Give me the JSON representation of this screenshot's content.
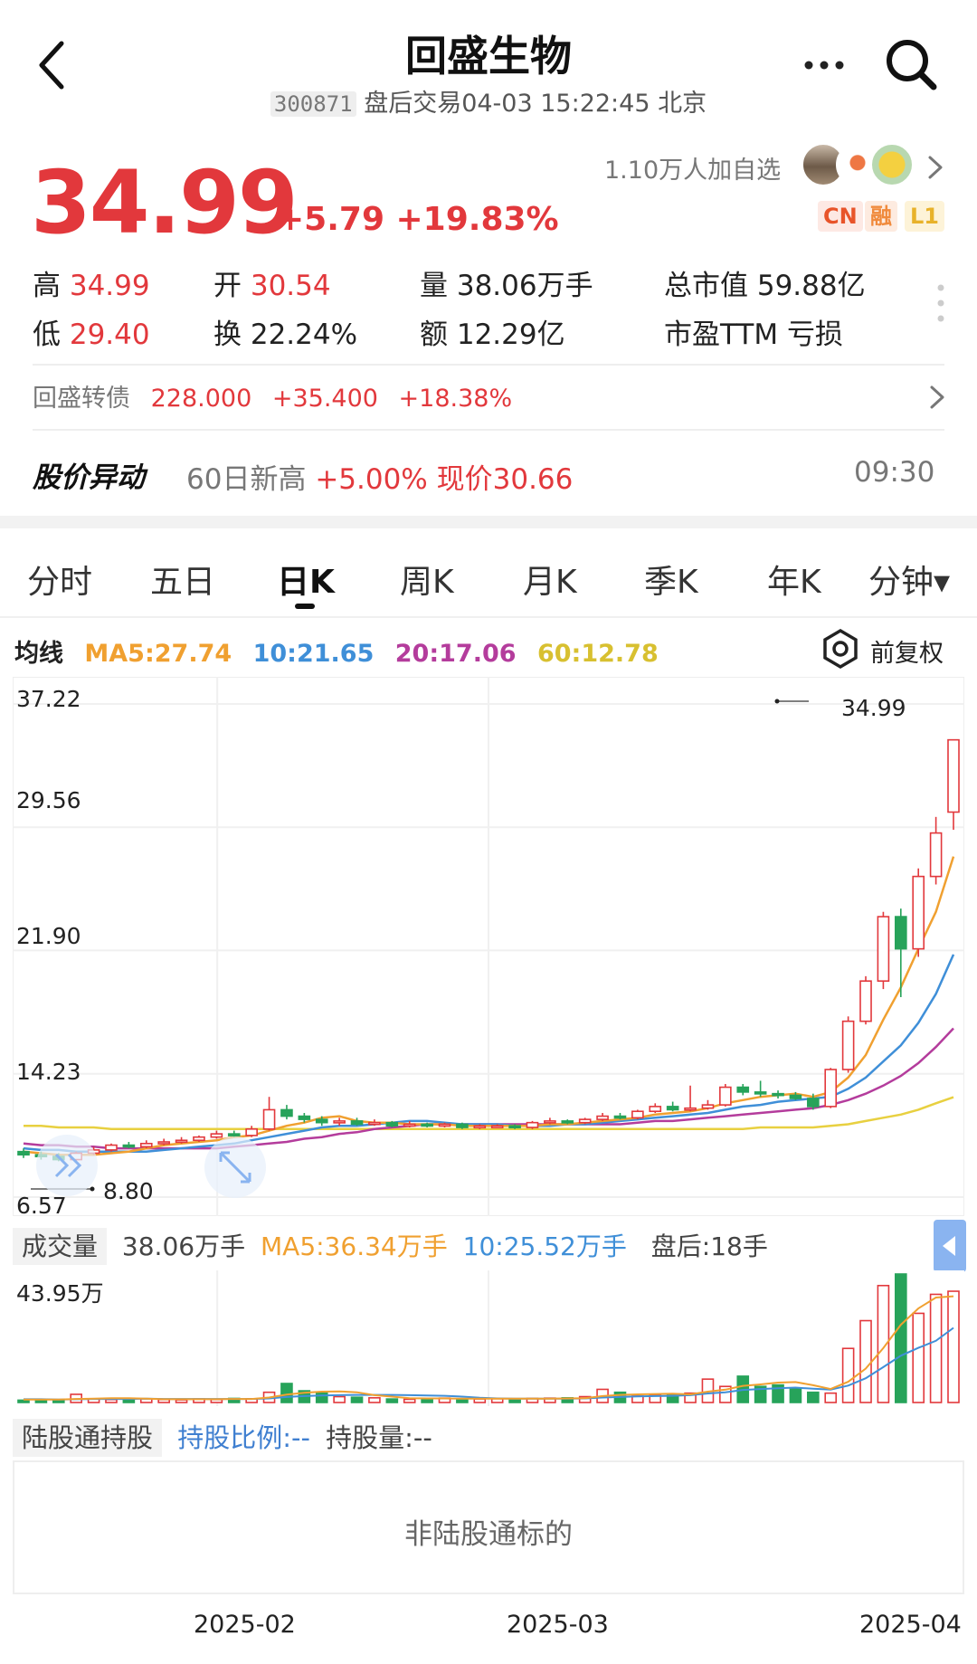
{
  "header": {
    "title": "回盛生物",
    "code": "300871",
    "status": "盘后交易04-03 15:22:45 北京"
  },
  "quote": {
    "price": "34.99",
    "change": "+5.79 +19.83%",
    "followers": "1.10万人加自选",
    "tags": [
      "CN",
      "融",
      "L1"
    ],
    "high_label": "高",
    "high": "34.99",
    "low_label": "低",
    "low": "29.40",
    "open_label": "开",
    "open": "30.54",
    "turnover_label": "换",
    "turnover": "22.24%",
    "volume_label": "量",
    "volume": "38.06万手",
    "amount_label": "额",
    "amount": "12.29亿",
    "mcap_label": "总市值",
    "mcap": "59.88亿",
    "pe_label": "市盈TTM",
    "pe": "亏损"
  },
  "bond": {
    "label": "回盛转债",
    "price": "228.000",
    "change": "+35.400",
    "pct": "+18.38%"
  },
  "alert": {
    "title": "股价异动",
    "text": "60日新高",
    "detail": "+5.00% 现价30.66",
    "time": "09:30"
  },
  "tabs": [
    "分时",
    "五日",
    "日K",
    "周K",
    "月K",
    "季K",
    "年K",
    "分钟▾"
  ],
  "ma": {
    "label": "均线",
    "ma5": "MA5:27.74",
    "ma10": "10:21.65",
    "ma20": "20:17.06",
    "ma60": "60:12.78",
    "adjust_label": "前复权"
  },
  "colors": {
    "up": "#e2383c",
    "down": "#27a35a",
    "ma5": "#f0a030",
    "ma10": "#3f8fd8",
    "ma20": "#b43c9c",
    "ma60": "#e8d040"
  },
  "kline": {
    "y_ticks": [
      "37.22",
      "29.56",
      "21.90",
      "14.23",
      "6.57"
    ],
    "high_mark": "34.99",
    "low_mark": "8.80"
  },
  "volume": {
    "label": "成交量",
    "value": "38.06万手",
    "ma5": "MA5:36.34万手",
    "ma10": "10:25.52万手",
    "after_hours": "盘后:18手",
    "max_label": "43.95万"
  },
  "hk_connect": {
    "label": "陆股通持股",
    "ratio": "持股比例:--",
    "amount": "持股量:--",
    "message": "非陆股通标的"
  },
  "dates": [
    "2025-02",
    "2025-03",
    "2025-04"
  ],
  "chart_data": {
    "type": "candlestick",
    "ylim": [
      6.57,
      37.22
    ],
    "y_ticks": [
      37.22,
      29.56,
      21.9,
      14.23,
      6.57
    ],
    "x_labels": [
      "2025-02",
      "2025-03",
      "2025-04"
    ],
    "candles": [
      [
        9.4,
        9.2,
        9.6,
        9.0
      ],
      [
        9.2,
        9.1,
        9.4,
        8.9
      ],
      [
        9.1,
        8.9,
        9.3,
        8.8
      ],
      [
        8.9,
        9.3,
        9.4,
        8.8
      ],
      [
        9.3,
        9.5,
        9.7,
        9.2
      ],
      [
        9.5,
        9.8,
        9.9,
        9.4
      ],
      [
        9.8,
        9.7,
        10.0,
        9.6
      ],
      [
        9.7,
        9.9,
        10.1,
        9.6
      ],
      [
        9.9,
        10.0,
        10.2,
        9.8
      ],
      [
        10.0,
        10.1,
        10.3,
        9.9
      ],
      [
        10.1,
        10.3,
        10.4,
        10.0
      ],
      [
        10.3,
        10.5,
        10.7,
        10.2
      ],
      [
        10.5,
        10.4,
        10.7,
        10.3
      ],
      [
        10.4,
        10.8,
        11.0,
        10.3
      ],
      [
        10.8,
        12.0,
        12.8,
        10.7
      ],
      [
        12.0,
        11.6,
        12.3,
        11.4
      ],
      [
        11.6,
        11.4,
        11.8,
        11.2
      ],
      [
        11.4,
        11.2,
        11.6,
        11.0
      ],
      [
        11.2,
        11.3,
        11.5,
        11.0
      ],
      [
        11.3,
        11.1,
        11.5,
        11.0
      ],
      [
        11.1,
        11.2,
        11.4,
        11.0
      ],
      [
        11.2,
        11.0,
        11.3,
        10.9
      ],
      [
        11.0,
        11.1,
        11.3,
        10.9
      ],
      [
        11.1,
        11.0,
        11.2,
        10.9
      ],
      [
        11.0,
        11.1,
        11.2,
        10.9
      ],
      [
        11.1,
        10.9,
        11.2,
        10.8
      ],
      [
        10.9,
        11.0,
        11.1,
        10.8
      ],
      [
        11.0,
        11.0,
        11.1,
        10.9
      ],
      [
        11.0,
        10.9,
        11.1,
        10.8
      ],
      [
        10.9,
        11.2,
        11.3,
        10.8
      ],
      [
        11.2,
        11.3,
        11.5,
        11.1
      ],
      [
        11.3,
        11.2,
        11.4,
        11.1
      ],
      [
        11.2,
        11.4,
        11.5,
        11.1
      ],
      [
        11.4,
        11.6,
        11.8,
        11.3
      ],
      [
        11.6,
        11.5,
        11.8,
        11.4
      ],
      [
        11.5,
        11.9,
        12.0,
        11.4
      ],
      [
        11.9,
        12.2,
        12.4,
        11.8
      ],
      [
        12.2,
        12.0,
        12.5,
        11.9
      ],
      [
        12.0,
        12.1,
        13.5,
        11.9
      ],
      [
        12.1,
        12.3,
        12.6,
        12.0
      ],
      [
        12.3,
        13.4,
        13.6,
        12.2
      ],
      [
        13.4,
        13.1,
        13.6,
        12.9
      ],
      [
        13.1,
        13.0,
        13.8,
        12.8
      ],
      [
        13.0,
        12.9,
        13.2,
        12.7
      ],
      [
        12.9,
        12.7,
        13.1,
        12.6
      ],
      [
        12.7,
        12.2,
        13.0,
        12.0
      ],
      [
        12.2,
        14.5,
        14.6,
        12.1
      ],
      [
        14.5,
        17.5,
        17.8,
        14.3
      ],
      [
        17.5,
        20.0,
        20.3,
        17.3
      ],
      [
        20.0,
        24.0,
        24.3,
        19.5
      ],
      [
        24.0,
        22.0,
        24.5,
        19.0
      ],
      [
        22.0,
        26.5,
        27.0,
        21.5
      ],
      [
        26.5,
        29.2,
        30.2,
        26.0
      ],
      [
        30.5,
        34.99,
        34.99,
        29.4
      ]
    ],
    "candle_fields": [
      "open",
      "close",
      "high",
      "low"
    ],
    "ma": {
      "MA5": [
        9.4,
        9.3,
        9.2,
        9.2,
        9.2,
        9.3,
        9.4,
        9.6,
        9.8,
        9.9,
        10.0,
        10.1,
        10.3,
        10.4,
        10.7,
        11.0,
        11.2,
        11.5,
        11.6,
        11.3,
        11.2,
        11.2,
        11.1,
        11.1,
        11.1,
        11.0,
        11.0,
        11.0,
        11.0,
        11.0,
        11.1,
        11.1,
        11.2,
        11.3,
        11.4,
        11.5,
        11.7,
        11.8,
        11.9,
        12.1,
        12.4,
        12.6,
        12.8,
        12.9,
        13.0,
        12.8,
        13.1,
        14.0,
        15.4,
        17.6,
        19.6,
        22.0,
        24.3,
        27.74
      ],
      "MA10": [
        9.6,
        9.5,
        9.5,
        9.4,
        9.4,
        9.4,
        9.4,
        9.4,
        9.5,
        9.6,
        9.7,
        9.8,
        9.9,
        10.1,
        10.3,
        10.5,
        10.7,
        10.9,
        11.0,
        11.0,
        11.1,
        11.2,
        11.3,
        11.3,
        11.2,
        11.1,
        11.1,
        11.1,
        11.0,
        11.0,
        11.0,
        11.1,
        11.1,
        11.2,
        11.3,
        11.4,
        11.5,
        11.6,
        11.7,
        11.8,
        12.0,
        12.2,
        12.3,
        12.5,
        12.6,
        12.7,
        12.8,
        13.3,
        14.0,
        15.0,
        16.0,
        17.4,
        19.2,
        21.65
      ],
      "MA20": [
        9.9,
        9.8,
        9.8,
        9.7,
        9.7,
        9.6,
        9.6,
        9.6,
        9.6,
        9.6,
        9.6,
        9.6,
        9.7,
        9.8,
        9.9,
        10.0,
        10.2,
        10.3,
        10.5,
        10.6,
        10.8,
        10.9,
        11.0,
        11.1,
        11.1,
        11.1,
        11.1,
        11.1,
        11.1,
        11.1,
        11.1,
        11.1,
        11.1,
        11.1,
        11.1,
        11.2,
        11.3,
        11.3,
        11.4,
        11.5,
        11.6,
        11.7,
        11.8,
        11.9,
        12.0,
        12.1,
        12.3,
        12.6,
        13.0,
        13.5,
        14.1,
        14.9,
        15.9,
        17.06
      ],
      "MA60": [
        11.0,
        11.0,
        10.9,
        10.9,
        10.9,
        10.8,
        10.8,
        10.8,
        10.8,
        10.8,
        10.8,
        10.8,
        10.8,
        10.8,
        10.8,
        10.8,
        10.8,
        10.8,
        10.8,
        10.8,
        10.8,
        10.8,
        10.8,
        10.8,
        10.8,
        10.8,
        10.8,
        10.8,
        10.8,
        10.8,
        10.8,
        10.8,
        10.8,
        10.8,
        10.8,
        10.8,
        10.8,
        10.8,
        10.8,
        10.8,
        10.8,
        10.8,
        10.9,
        10.9,
        10.9,
        10.9,
        11.0,
        11.1,
        11.3,
        11.5,
        11.7,
        12.0,
        12.4,
        12.78
      ]
    },
    "volume_ylim": [
      0,
      43.95
    ],
    "volume_unit": "万手",
    "volume": [
      0.8,
      0.7,
      0.9,
      2.8,
      1.2,
      1.0,
      1.1,
      1.3,
      1.0,
      0.9,
      1.2,
      1.0,
      1.4,
      1.3,
      3.5,
      6.5,
      4.0,
      3.2,
      2.0,
      1.8,
      1.6,
      1.2,
      1.1,
      1.4,
      1.5,
      1.3,
      1.2,
      1.3,
      1.2,
      1.4,
      1.5,
      1.6,
      2.0,
      4.5,
      3.5,
      2.2,
      2.5,
      2.8,
      3.2,
      8.0,
      5.5,
      9.0,
      5.5,
      6.0,
      5.0,
      3.5,
      3.2,
      18.5,
      28.0,
      40.0,
      43.95,
      30.5,
      37.0,
      38.06
    ],
    "volume_ma5": [
      1.0,
      1.0,
      1.0,
      1.2,
      1.3,
      1.5,
      1.5,
      1.3,
      1.1,
      1.1,
      1.1,
      1.1,
      1.2,
      1.2,
      1.7,
      2.7,
      3.3,
      3.7,
      3.8,
      3.5,
      2.5,
      2.0,
      1.5,
      1.4,
      1.4,
      1.3,
      1.3,
      1.3,
      1.3,
      1.3,
      1.3,
      1.4,
      1.5,
      2.2,
      2.6,
      2.8,
      2.9,
      3.0,
      2.8,
      3.7,
      4.4,
      5.7,
      6.2,
      6.8,
      7.0,
      5.9,
      4.6,
      7.1,
      11.6,
      18.6,
      26.6,
      32.2,
      35.9,
      36.34
    ],
    "volume_ma10": [
      1.1,
      1.1,
      1.0,
      1.1,
      1.2,
      1.2,
      1.2,
      1.3,
      1.2,
      1.2,
      1.2,
      1.2,
      1.2,
      1.2,
      1.4,
      1.9,
      2.2,
      2.4,
      2.5,
      2.6,
      2.6,
      2.6,
      2.5,
      2.4,
      2.3,
      2.0,
      1.6,
      1.4,
      1.3,
      1.3,
      1.3,
      1.3,
      1.4,
      1.7,
      1.9,
      2.1,
      2.2,
      2.3,
      2.5,
      3.1,
      3.5,
      4.3,
      4.6,
      4.9,
      5.1,
      4.7,
      4.4,
      5.8,
      8.3,
      12.1,
      16.0,
      18.7,
      21.1,
      25.52
    ]
  }
}
